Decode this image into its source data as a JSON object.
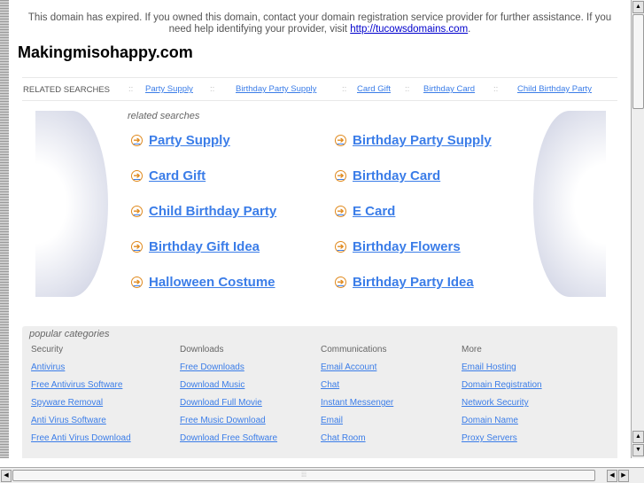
{
  "notice": {
    "text": "This domain has expired. If you owned this domain, contact your domain registration service provider for further assistance. If you need help identifying your provider, visit ",
    "link": "http://tucowsdomains.com",
    "end": "."
  },
  "site_title": "Makingmisohappy.com",
  "related_bar": {
    "label": "RELATED SEARCHES",
    "sep": "::",
    "items": [
      "Party Supply",
      "Birthday Party Supply",
      "Card Gift",
      "Birthday Card",
      "Child Birthday Party"
    ]
  },
  "related": {
    "heading": "related searches",
    "items": [
      "Party Supply",
      "Birthday Party Supply",
      "Card Gift",
      "Birthday Card",
      "Child Birthday Party",
      "E Card",
      "Birthday Gift Idea",
      "Birthday Flowers",
      "Halloween Costume",
      "Birthday Party Idea"
    ]
  },
  "popular": {
    "heading": "popular categories",
    "columns": [
      {
        "title": "Security",
        "links": [
          "Antivirus",
          "Free Antivirus Software",
          "Spyware Removal",
          "Anti Virus Software",
          "Free Anti Virus Download"
        ]
      },
      {
        "title": "Downloads",
        "links": [
          "Free Downloads",
          "Download Music",
          "Download Full Movie",
          "Free Music Download",
          "Download Free Software"
        ]
      },
      {
        "title": "Communications",
        "links": [
          "Email Account",
          "Chat",
          "Instant Messenger",
          "Email",
          "Chat Room"
        ]
      },
      {
        "title": "More",
        "links": [
          "Email Hosting",
          "Domain Registration",
          "Network Security",
          "Domain Name",
          "Proxy Servers"
        ]
      }
    ]
  }
}
